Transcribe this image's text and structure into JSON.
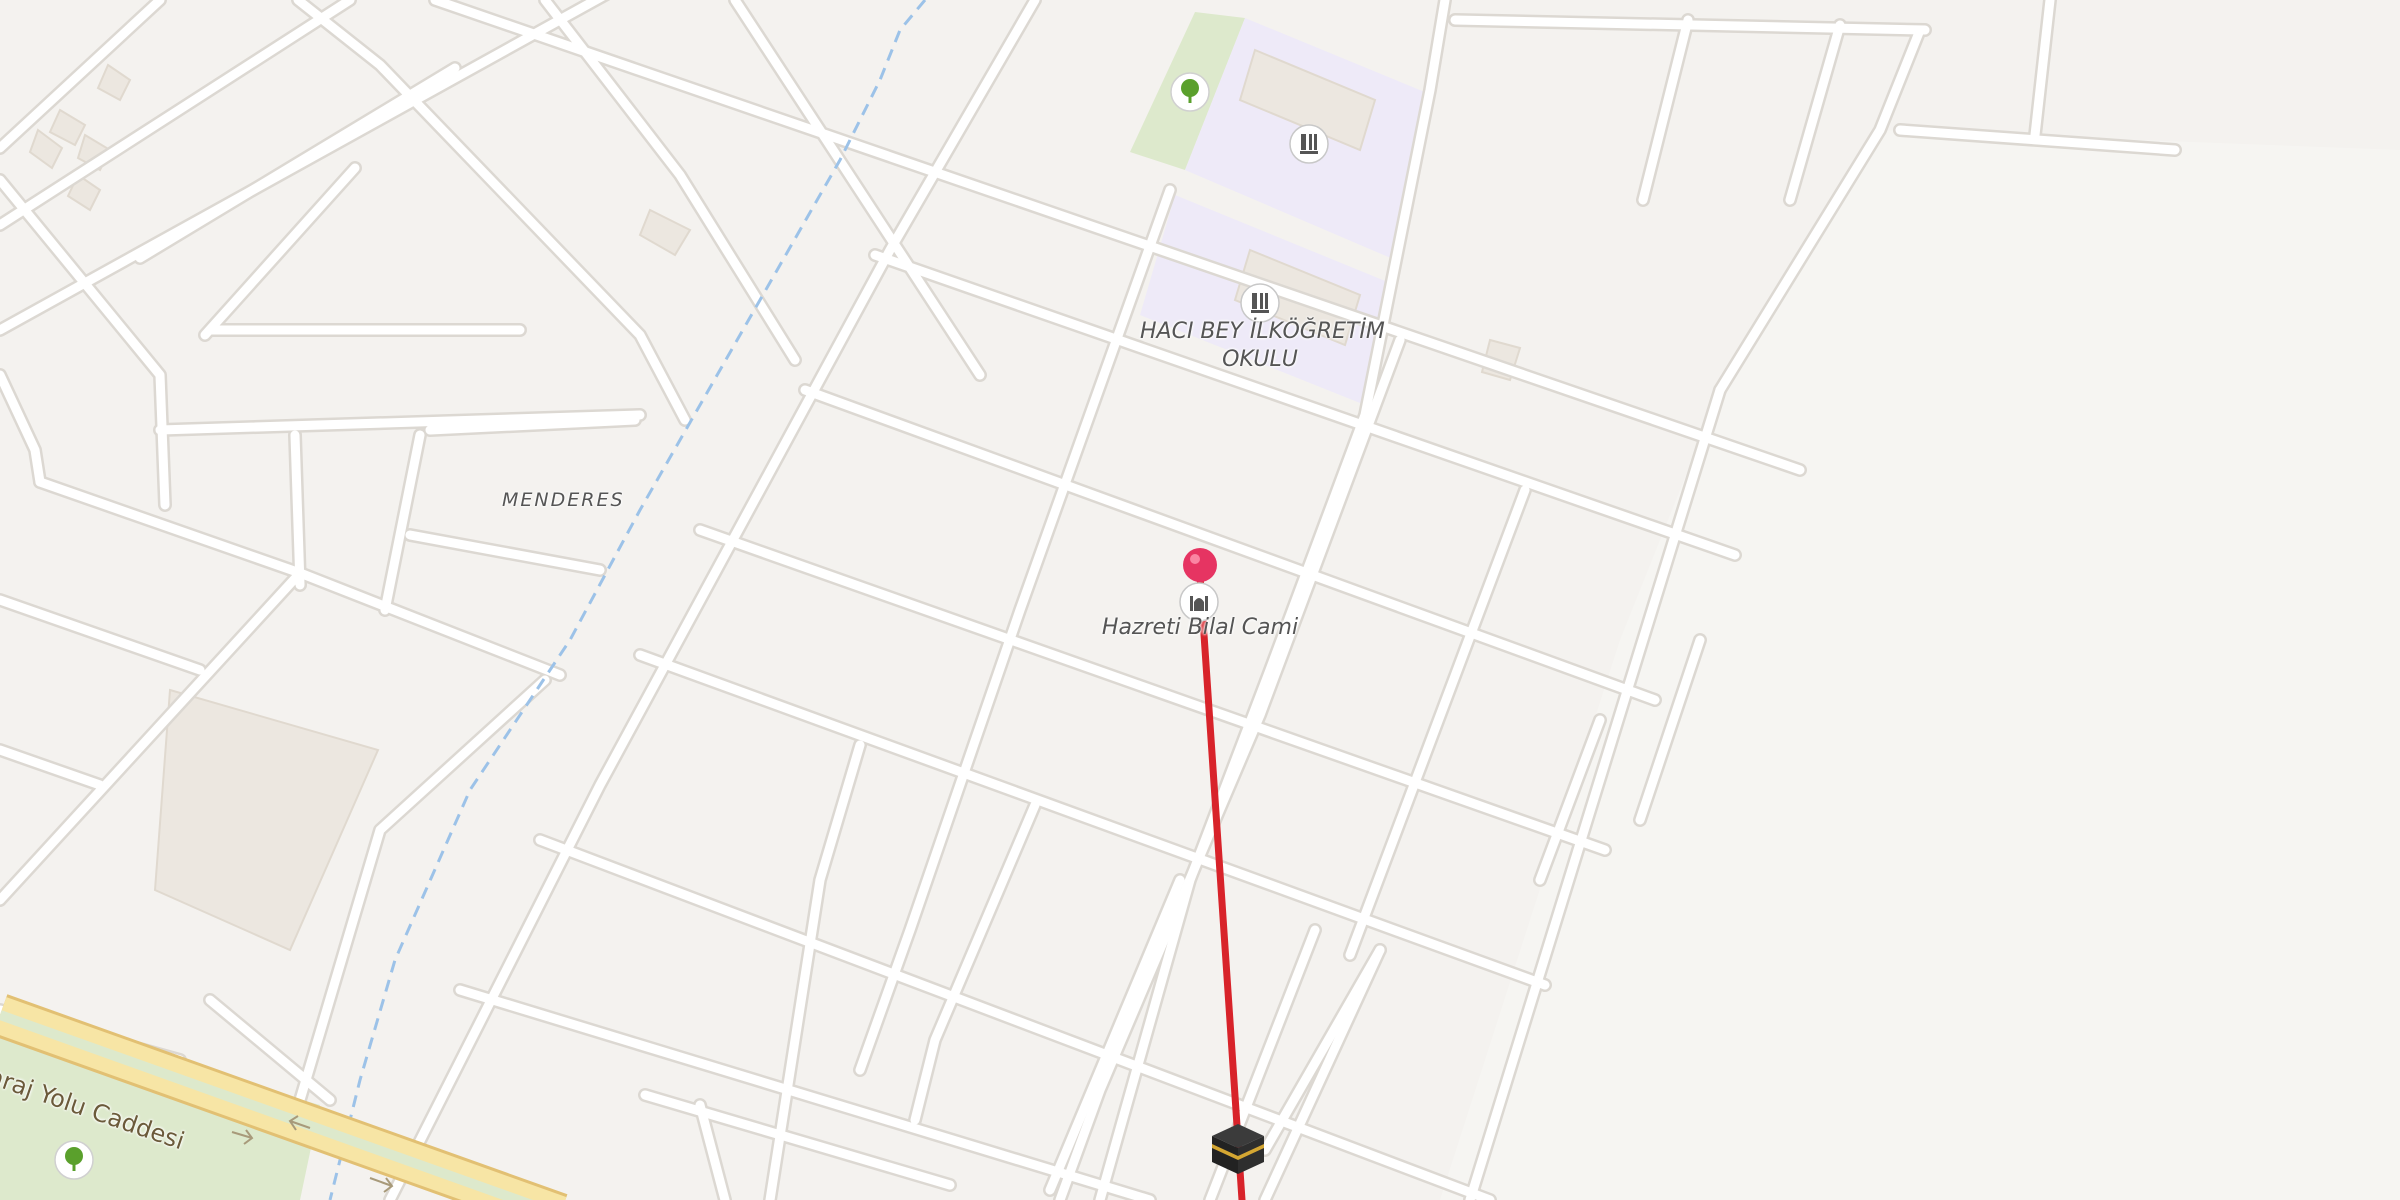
{
  "map": {
    "labels": {
      "district": "MENDERES",
      "school_line1": "HACI BEY İLKÖĞRETİM",
      "school_line2": "OKULU",
      "mosque": "Hazreti Bilal Cami",
      "street": "araj Yolu Caddesi"
    },
    "icons": {
      "park": "tree-icon",
      "school": "school-icon",
      "mosque": "mosque-icon",
      "destination": "kaaba-icon",
      "origin": "map-pin-icon"
    },
    "colors": {
      "background": "#f4f2ef",
      "road": "#ffffff",
      "road_casing": "#dcd8d2",
      "main_road": "#f7e5a5",
      "main_road_casing": "#e2c073",
      "waterway": "#9cc2e8",
      "park": "#dde9cc",
      "school_area": "#eeeaf8",
      "building": "#ece7e0",
      "qibla_line": "#d8232a",
      "pin": "#e63462"
    }
  }
}
